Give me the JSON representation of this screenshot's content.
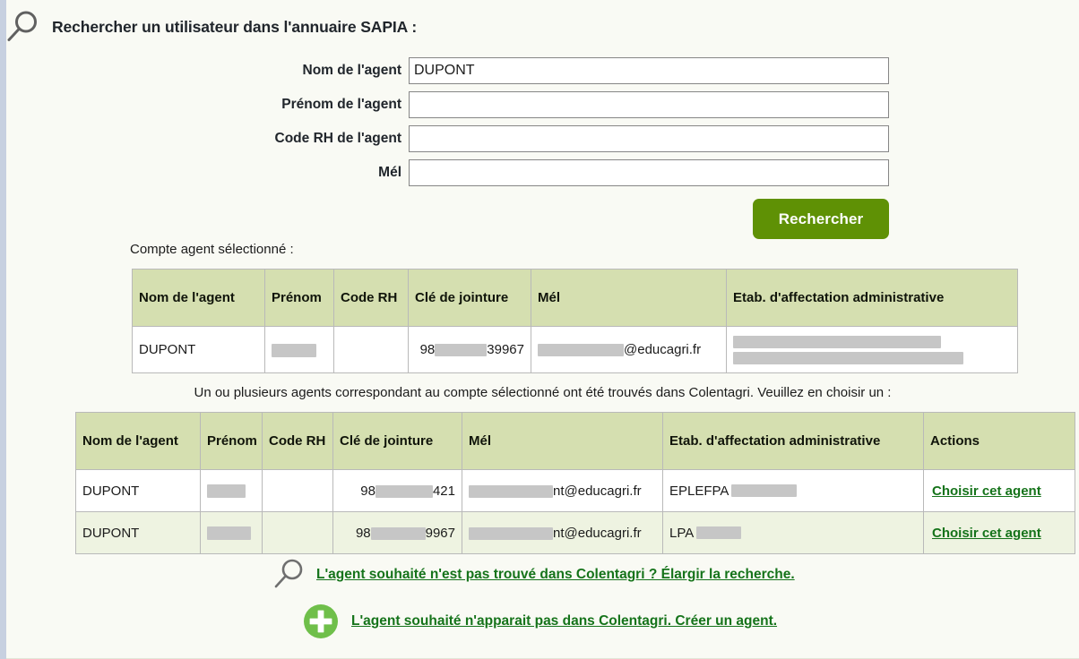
{
  "header": {
    "icon": "search-icon",
    "title": "Rechercher un utilisateur dans l'annuaire SAPIA :"
  },
  "search_form": {
    "fields": [
      {
        "label": "Nom de l'agent",
        "value": "DUPONT",
        "placeholder": ""
      },
      {
        "label": "Prénom de l'agent",
        "value": "",
        "placeholder": ""
      },
      {
        "label": "Code RH de l'agent",
        "value": "",
        "placeholder": ""
      },
      {
        "label": "Mél",
        "value": "",
        "placeholder": ""
      }
    ],
    "submit_label": "Rechercher",
    "submit_color": "#5f9105"
  },
  "selected_account": {
    "caption": "Compte agent sélectionné :",
    "columns": [
      "Nom de l'agent",
      "Prénom",
      "Code RH",
      "Clé de jointure",
      "Mél",
      "Etab. d'affectation administrative"
    ],
    "rows": [
      {
        "nom": "DUPONT",
        "prenom": "",
        "prenom_redacted": true,
        "code_rh": "",
        "cle_prefix": "98",
        "cle_suffix": "39967",
        "mel_suffix": "@educagri.fr",
        "etab_lines": 2,
        "etab": ""
      }
    ]
  },
  "candidates": {
    "caption": "Un ou plusieurs agents correspondant au compte sélectionné ont été trouvés dans Colentagri. Veuillez en choisir un :",
    "columns": [
      "Nom de l'agent",
      "Prénom",
      "Code RH",
      "Clé de jointure",
      "Mél",
      "Etab. d'affectation administrative",
      "Actions"
    ],
    "rows": [
      {
        "nom": "DUPONT",
        "prenom": "",
        "code_rh": "",
        "cle_prefix": "98",
        "cle_suffix": "421",
        "mel_suffix": "nt@educagri.fr",
        "etab": "EPLEFPA",
        "action_label": "Choisir cet agent"
      },
      {
        "nom": "DUPONT",
        "prenom": "",
        "code_rh": "",
        "cle_prefix": "98",
        "cle_suffix": "9967",
        "mel_suffix": "nt@educagri.fr",
        "etab": "LPA",
        "action_label": "Choisir cet agent"
      }
    ]
  },
  "bottom_actions": [
    {
      "icon": "search-icon",
      "label": "L'agent souhaité n'est pas trouvé dans Colentagri ? Élargir la recherche."
    },
    {
      "icon": "plus-circle-icon",
      "label": "L'agent souhaité n'apparait pas dans Colentagri. Créer un agent."
    }
  ],
  "colors": {
    "accent_green": "#5f9105",
    "link_green": "#15731a",
    "table_header": "#d5dfb0",
    "row_alt": "#eef3e1",
    "page_bg": "#f9faf4",
    "left_rail": "#c7d0e0",
    "redaction": "#c6c6c6",
    "plus_circle": "#6fbf4a"
  }
}
